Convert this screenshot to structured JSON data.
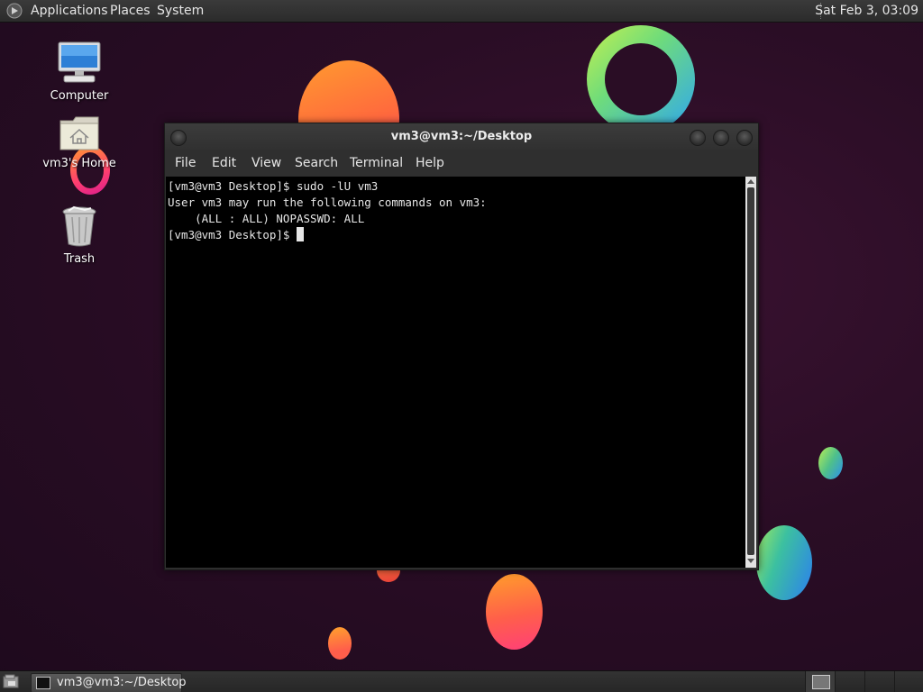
{
  "top_panel": {
    "menus": [
      "Applications",
      "Places",
      "System"
    ],
    "clock": "Sat Feb  3, 03:09"
  },
  "desktop_icons": [
    {
      "label": "Computer",
      "icon": "computer-icon"
    },
    {
      "label": "vm3's Home",
      "icon": "home-folder-icon"
    },
    {
      "label": "Trash",
      "icon": "trash-icon"
    }
  ],
  "terminal": {
    "title": "vm3@vm3:~/Desktop",
    "menus": [
      "File",
      "Edit",
      "View",
      "Search",
      "Terminal",
      "Help"
    ],
    "lines": [
      "[vm3@vm3 Desktop]$ sudo -lU vm3",
      "User vm3 may run the following commands on vm3:",
      "    (ALL : ALL) NOPASSWD: ALL"
    ],
    "prompt": "[vm3@vm3 Desktop]$ "
  },
  "taskbar": {
    "task_label": "vm3@vm3:~/Desktop",
    "workspaces": 4
  }
}
